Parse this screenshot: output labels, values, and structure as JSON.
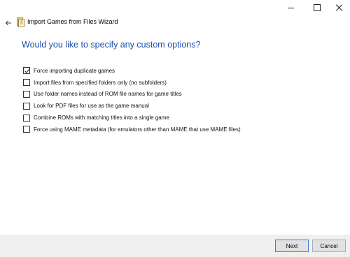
{
  "window": {
    "title": "Import Games from Files Wizard"
  },
  "page": {
    "heading": "Would you like to specify any custom options?"
  },
  "options": [
    {
      "label": "Force importing duplicate games",
      "checked": true
    },
    {
      "label": "Import files from specified folders only (no subfolders)",
      "checked": false
    },
    {
      "label": "Use folder names instead of ROM file names for game titles",
      "checked": false
    },
    {
      "label": "Look for PDF files for use as the game manual",
      "checked": false
    },
    {
      "label": "Combine ROMs with matching titles into a single game",
      "checked": false
    },
    {
      "label": "Force using MAME metadata (for emulators other than MAME that use MAME files)",
      "checked": false
    }
  ],
  "buttons": {
    "next": "Next",
    "cancel": "Cancel"
  },
  "colors": {
    "heading": "#1a4ea7",
    "default_button_border": "#3a7ad9",
    "footer_background": "#f0f0f0"
  },
  "icons": {
    "back": "arrow-left-icon",
    "wizard": "wizard-document-icon",
    "minimize": "minimize-icon",
    "maximize": "maximize-icon",
    "close": "close-icon"
  }
}
